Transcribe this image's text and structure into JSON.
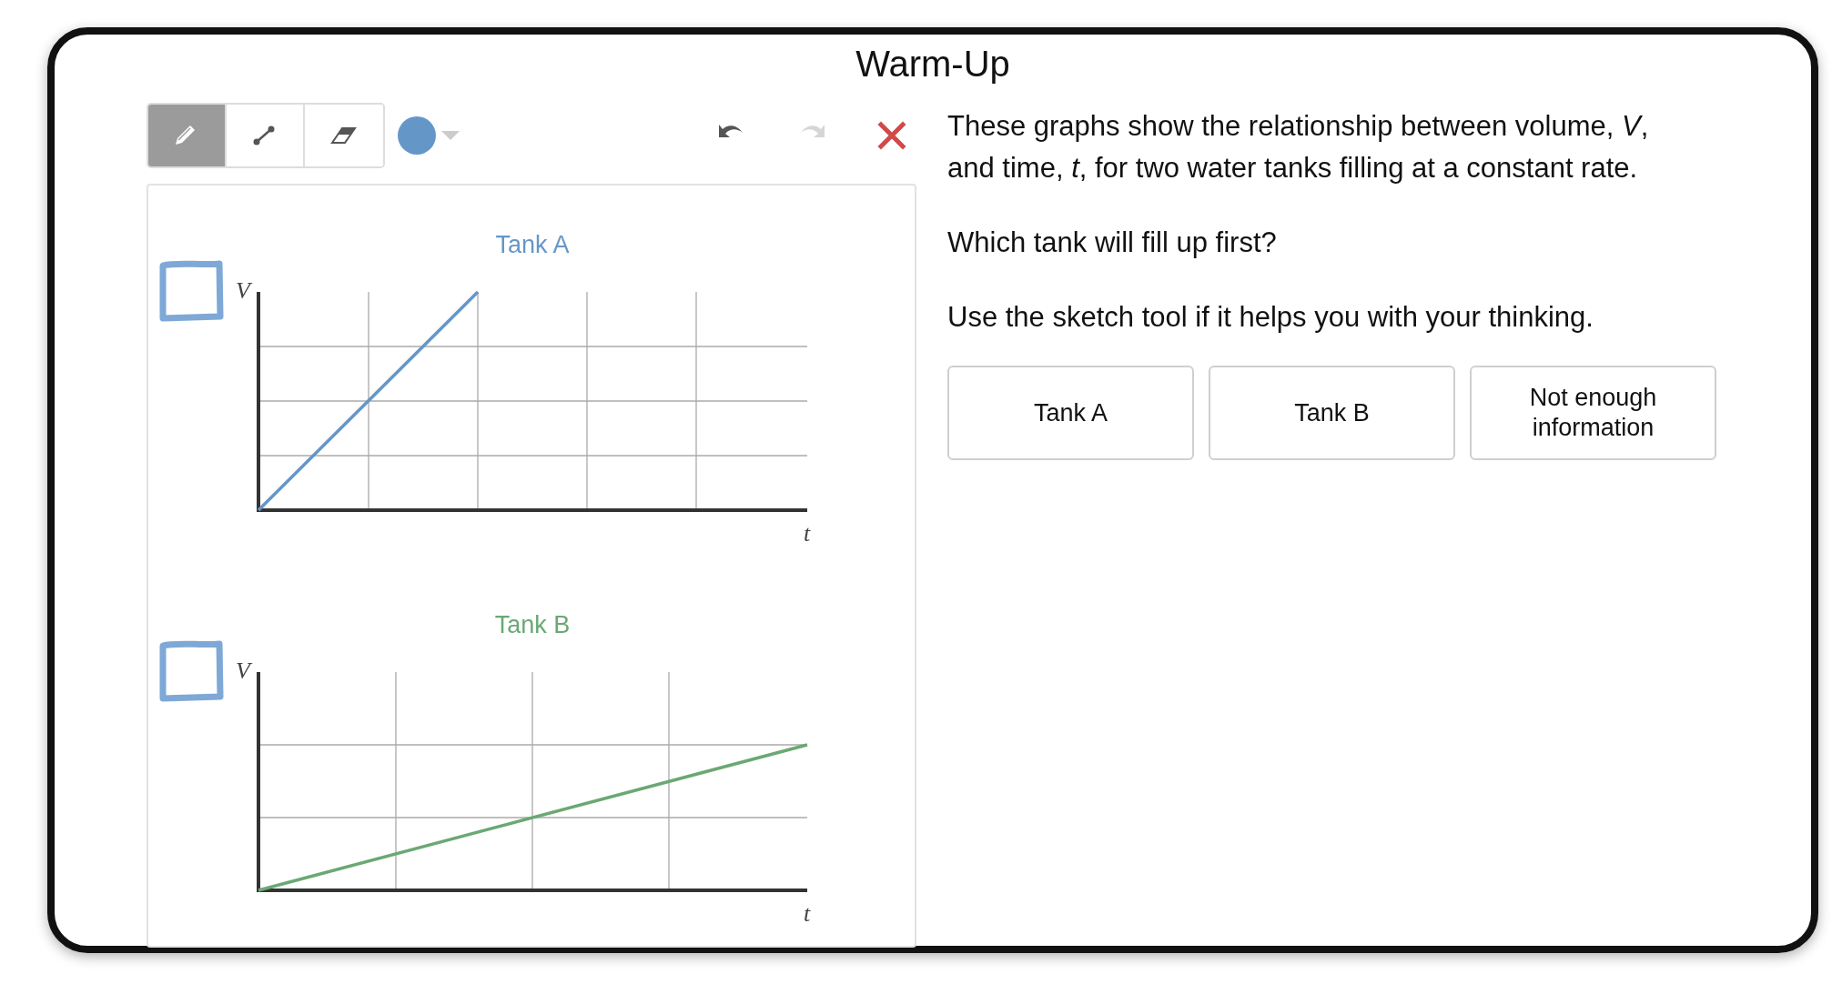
{
  "title": "Warm-Up",
  "toolbar": {
    "tools": [
      {
        "kind": "pencil",
        "selected": true
      },
      {
        "kind": "line",
        "selected": false
      },
      {
        "kind": "eraser",
        "selected": false
      }
    ],
    "color_picker": {
      "color": "#6596c8"
    },
    "actions": [
      {
        "kind": "undo",
        "disabled": false
      },
      {
        "kind": "redo",
        "disabled": true
      },
      {
        "kind": "clear"
      }
    ]
  },
  "graphs": [
    {
      "title": "Tank A",
      "color": "#6596c8",
      "y_label": "V",
      "x_label": "t",
      "kind": "steep"
    },
    {
      "title": "Tank B",
      "color": "#6aa874",
      "y_label": "V",
      "x_label": "t",
      "kind": "shallow"
    }
  ],
  "prompt": [
    "These graphs show the relationship between volume, *V*, and time, *t*, for two water tanks filling at a constant rate.",
    "Which tank will fill up first?",
    "Use the sketch tool if it helps you with your thinking."
  ],
  "choices": [
    {
      "label": "Tank A",
      "selected": false
    },
    {
      "label": "Tank B",
      "selected": false
    },
    {
      "label": "Not enough information",
      "selected": false
    }
  ]
}
